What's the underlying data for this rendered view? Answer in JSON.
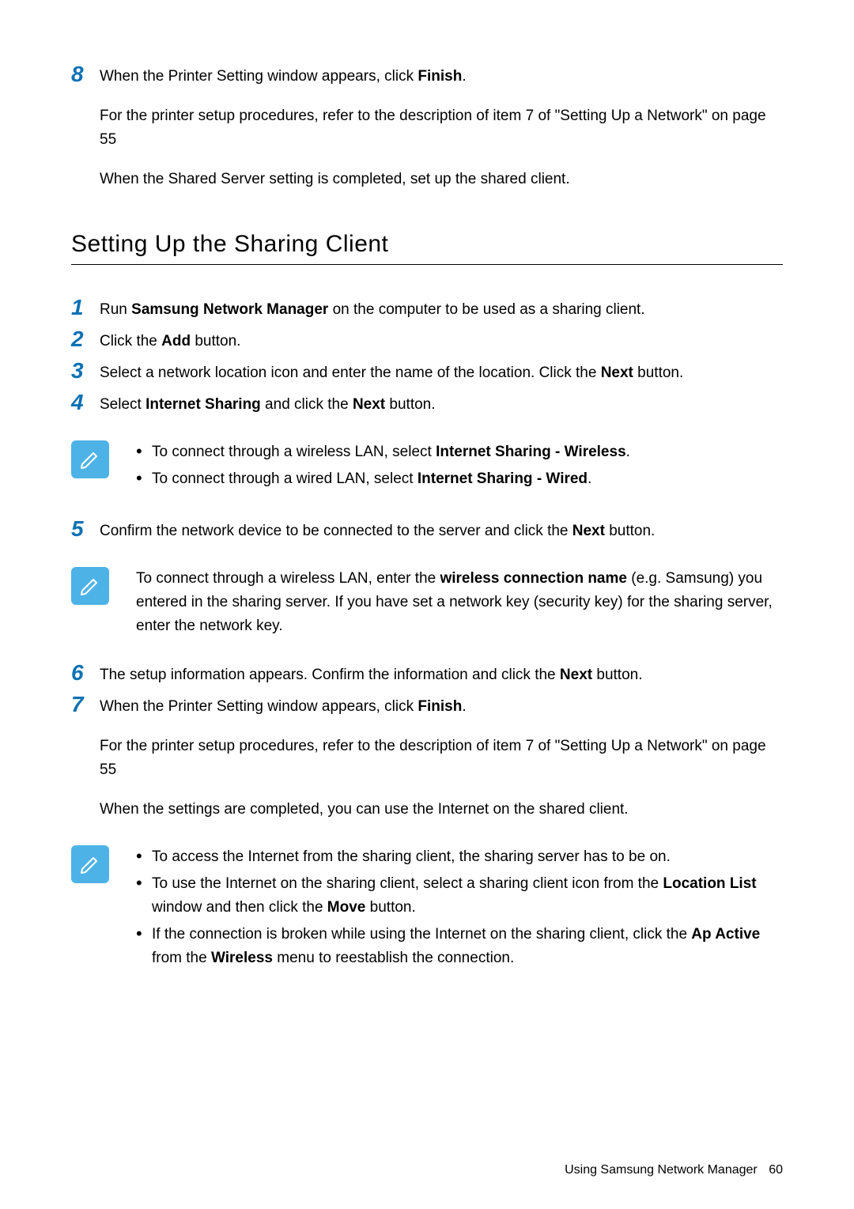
{
  "step8": {
    "num": "8",
    "line1_pre": "When the Printer Setting window appears, click ",
    "line1_bold": "Finish",
    "line1_post": ".",
    "line2": "For the printer setup procedures, refer to the description of item 7 of  \"Setting Up a Network\" on page 55",
    "line3": "When the Shared Server setting is completed, set up the shared client."
  },
  "section_title": "Setting Up the Sharing Client",
  "client": {
    "s1": {
      "num": "1",
      "pre": "Run ",
      "bold": "Samsung Network Manager",
      "post": " on the computer to be used as a sharing client."
    },
    "s2": {
      "num": "2",
      "pre": "Click the ",
      "bold": "Add",
      "post": " button."
    },
    "s3": {
      "num": "3",
      "pre": "Select a network location icon and enter the name of the location. Click the ",
      "bold": "Next",
      "post": " button."
    },
    "s4": {
      "num": "4",
      "pre": "Select ",
      "bold": "Internet Sharing",
      "mid": " and click the ",
      "bold2": "Next",
      "post": " button."
    },
    "s5": {
      "num": "5",
      "pre": "Confirm the network device to be connected to the server and click the ",
      "bold": "Next",
      "post": " button."
    },
    "s6": {
      "num": "6",
      "pre": "The setup information appears. Confirm the information and click the ",
      "bold": "Next",
      "post": " button."
    },
    "s7": {
      "num": "7",
      "pre": "When the Printer Setting window appears, click ",
      "bold": "Finish",
      "post": ".",
      "line2": "For the printer setup procedures, refer to the description of item 7 of  \"Setting Up a Network\" on page 55",
      "line3": "When the settings are completed, you can use the Internet on the shared client."
    }
  },
  "note1": {
    "b1_pre": "To connect through a wireless LAN, select ",
    "b1_bold": "Internet Sharing - Wireless",
    "b1_post": ".",
    "b2_pre": "To connect through a wired LAN, select ",
    "b2_bold": "Internet Sharing - Wired",
    "b2_post": "."
  },
  "note2": {
    "pre": "To connect through a wireless LAN, enter the ",
    "bold": "wireless connection name",
    "post": " (e.g. Samsung) you entered in the sharing server. If you have set a network key (security key) for the sharing server, enter the network key."
  },
  "note3": {
    "b1": "To access the Internet from the sharing client, the sharing server has to be on.",
    "b2_pre": "To use the Internet on the sharing client, select a sharing client icon from the ",
    "b2_bold": "Location List",
    "b2_mid": " window and then click the ",
    "b2_bold2": "Move",
    "b2_post": " button.",
    "b3_pre": "If the connection is broken while using the Internet on the sharing client, click the ",
    "b3_bold": "Ap Active",
    "b3_mid": " from the ",
    "b3_bold2": "Wireless",
    "b3_post": " menu to reestablish the connection."
  },
  "footer": {
    "text": "Using Samsung Network Manager",
    "page": "60"
  }
}
